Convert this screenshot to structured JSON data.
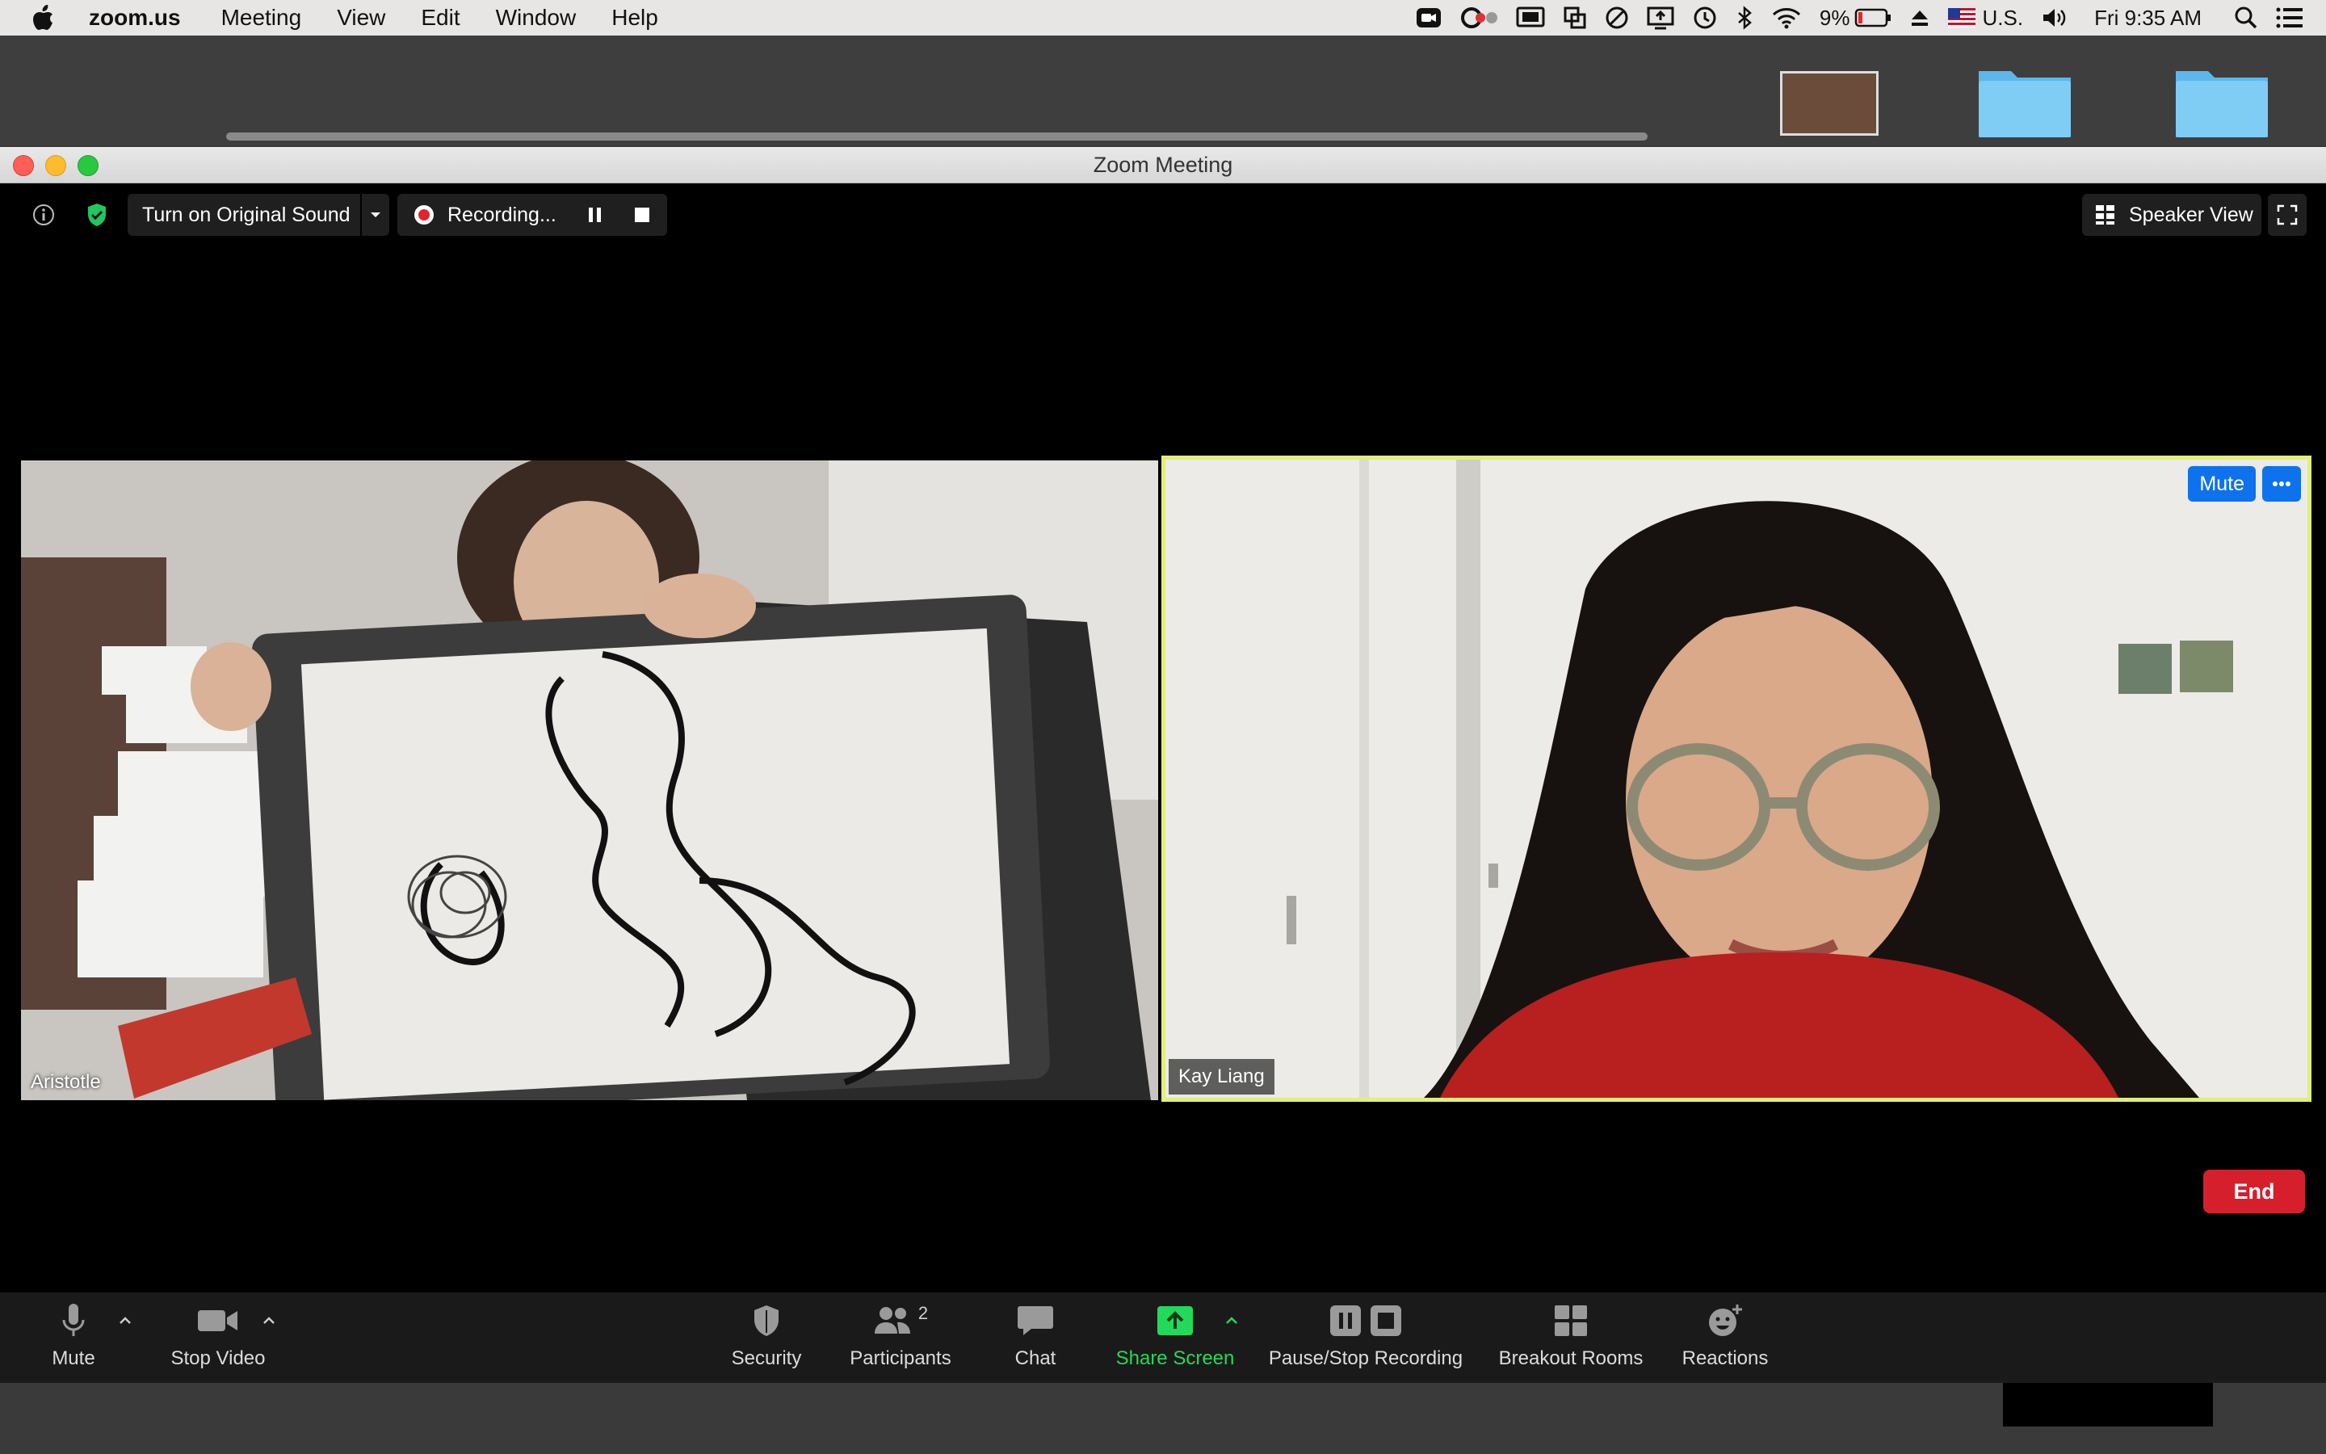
{
  "menubar": {
    "app_name": "zoom.us",
    "items": [
      "Meeting",
      "View",
      "Edit",
      "Window",
      "Help"
    ],
    "battery": "9%",
    "input_source": "U.S.",
    "clock": "Fri 9:35 AM"
  },
  "window": {
    "title": "Zoom Meeting"
  },
  "topbar": {
    "original_sound_label": "Turn on Original Sound",
    "recording_label": "Recording...",
    "speaker_view_label": "Speaker View"
  },
  "participants_video": [
    {
      "name": "Aristotle"
    },
    {
      "name": "Kay Liang",
      "mute_label": "Mute",
      "active_speaker": true
    }
  ],
  "toolbar": {
    "mute": "Mute",
    "stop_video": "Stop Video",
    "security": "Security",
    "participants": "Participants",
    "participants_count": "2",
    "chat": "Chat",
    "share_screen": "Share Screen",
    "pause_stop_recording": "Pause/Stop Recording",
    "breakout_rooms": "Breakout Rooms",
    "reactions": "Reactions",
    "end": "End"
  },
  "colors": {
    "share_green": "#23d959",
    "end_red": "#d61f2d",
    "accent_blue": "#0e72ed",
    "speaker_highlight": "#e3ee7a"
  }
}
